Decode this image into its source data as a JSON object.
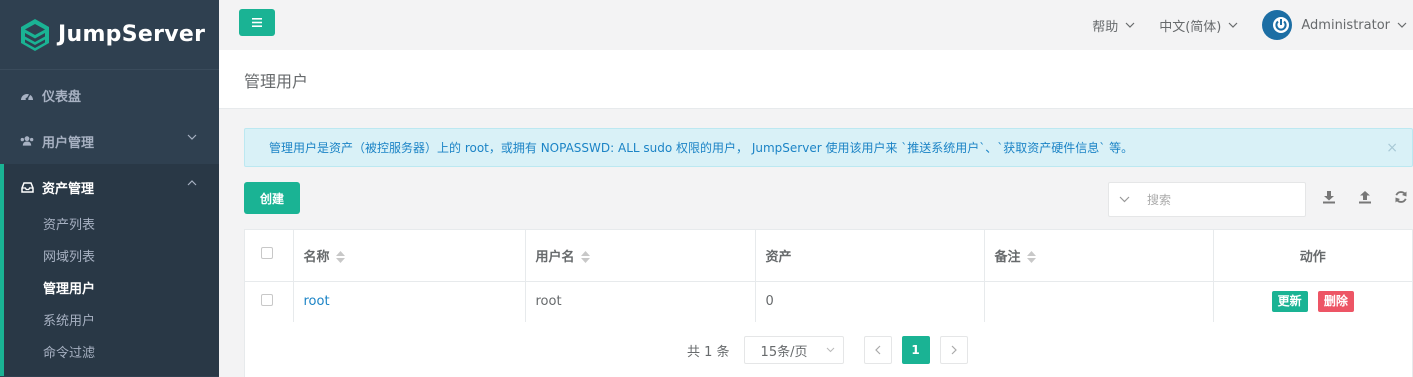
{
  "brand": {
    "name": "JumpServer"
  },
  "sidebar": {
    "items": [
      {
        "label": "仪表盘",
        "icon": "dashboard-icon"
      },
      {
        "label": "用户管理",
        "icon": "users-icon"
      }
    ],
    "group": {
      "label": "资产管理",
      "icon": "inbox-icon",
      "children": [
        {
          "label": "资产列表"
        },
        {
          "label": "网域列表"
        },
        {
          "label": "管理用户"
        },
        {
          "label": "系统用户"
        },
        {
          "label": "命令过滤"
        }
      ]
    }
  },
  "topbar": {
    "help": "帮助",
    "language": "中文(简体)",
    "user": "Administrator"
  },
  "page": {
    "title": "管理用户"
  },
  "alert": {
    "text": "管理用户是资产（被控服务器）上的 root，或拥有 NOPASSWD: ALL sudo 权限的用户， JumpServer 使用该用户来 `推送系统用户`、`获取资产硬件信息` 等。",
    "close": "×"
  },
  "toolbar": {
    "create": "创建",
    "search_placeholder": "搜索"
  },
  "table": {
    "columns": [
      "名称",
      "用户名",
      "资产",
      "备注",
      "动作"
    ],
    "rows": [
      {
        "name": "root",
        "username": "root",
        "assets": "0",
        "comment": "",
        "update": "更新",
        "delete": "删除"
      }
    ]
  },
  "pagination": {
    "total": "共 1 条",
    "page_size": "15条/页",
    "current_page": "1"
  },
  "colors": {
    "accent": "#1ab394",
    "danger": "#ed5565",
    "sidebar": "#2f4050",
    "link": "#1c84c6"
  }
}
